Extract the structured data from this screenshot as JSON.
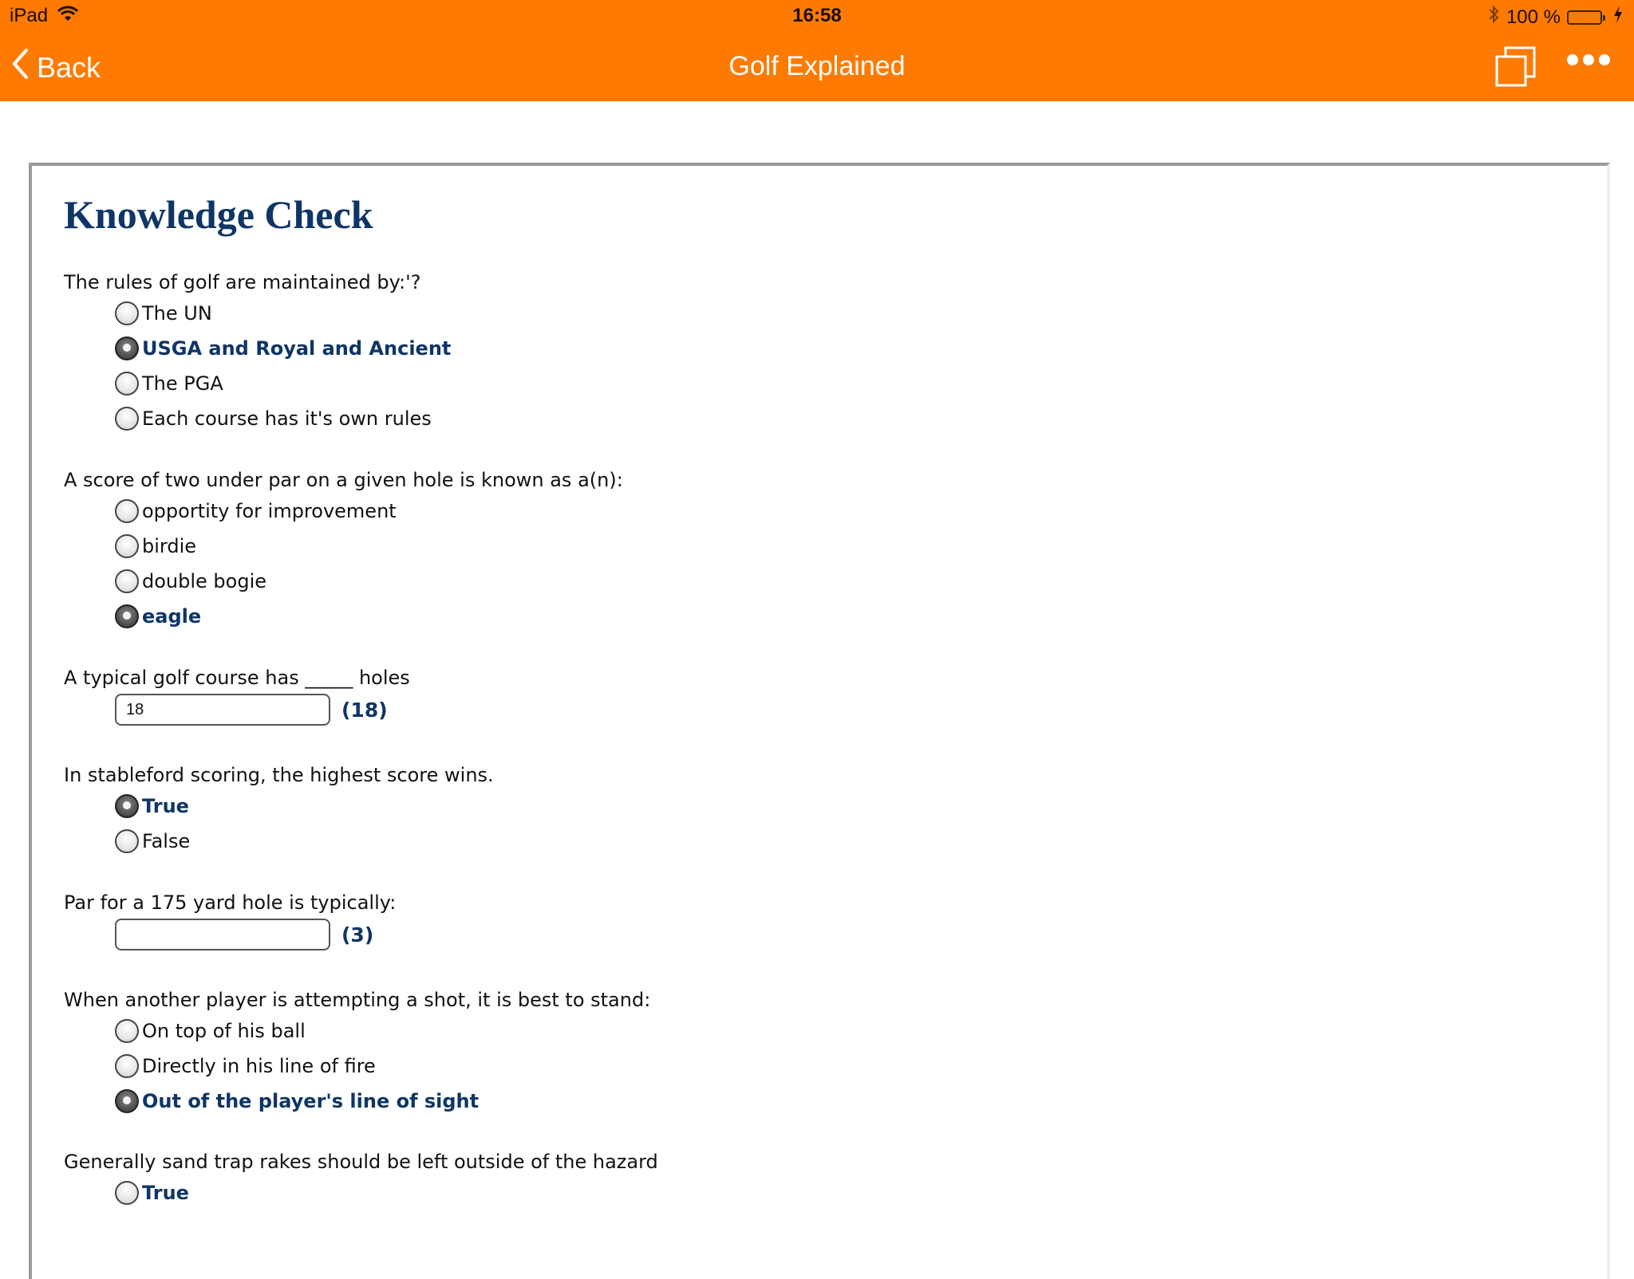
{
  "status_bar": {
    "device": "iPad",
    "time": "16:58",
    "battery_percent": "100 %",
    "battery_level": 1.0,
    "colors": {
      "battery_fill": "#4cd964"
    }
  },
  "nav": {
    "back_label": "Back",
    "title": "Golf Explained",
    "icons": [
      "chevron-left-icon",
      "copy-icon",
      "more-icon"
    ],
    "colors": {
      "bar": "#ff7a00",
      "text": "#ffffff"
    }
  },
  "page": {
    "title": "Knowledge Check",
    "colors": {
      "title": "#0e3566",
      "correct": "#0e3566"
    },
    "questions": [
      {
        "text": "The rules of golf are maintained by:'?",
        "type": "radio",
        "options": [
          {
            "label": "The UN",
            "selected": false,
            "correct": false
          },
          {
            "label": "USGA and Royal and Ancient",
            "selected": true,
            "correct": true
          },
          {
            "label": "The PGA",
            "selected": false,
            "correct": false
          },
          {
            "label": "Each course has it's own rules",
            "selected": false,
            "correct": false
          }
        ]
      },
      {
        "text": "A score of two under par on a given hole is known as a(n):",
        "type": "radio",
        "options": [
          {
            "label": "opportity for improvement",
            "selected": false,
            "correct": false
          },
          {
            "label": "birdie",
            "selected": false,
            "correct": false
          },
          {
            "label": "double bogie",
            "selected": false,
            "correct": false
          },
          {
            "label": "eagle",
            "selected": true,
            "correct": true
          }
        ]
      },
      {
        "text": "A typical golf course has _____ holes",
        "type": "fill",
        "value": "18",
        "answer": "(18)"
      },
      {
        "text": "In stableford scoring, the highest score wins.",
        "type": "radio",
        "options": [
          {
            "label": "True",
            "selected": true,
            "correct": true
          },
          {
            "label": "False",
            "selected": false,
            "correct": false
          }
        ]
      },
      {
        "text": "Par for a 175 yard hole is typically:",
        "type": "fill",
        "value": "",
        "answer": "(3)"
      },
      {
        "text": "When another player is attempting a shot, it is best to stand:",
        "type": "radio",
        "options": [
          {
            "label": "On top of his ball",
            "selected": false,
            "correct": false
          },
          {
            "label": "Directly in his line of fire",
            "selected": false,
            "correct": false
          },
          {
            "label": "Out of the player's line of sight",
            "selected": true,
            "correct": true
          }
        ]
      },
      {
        "text": "Generally sand trap rakes should be left outside of the hazard",
        "type": "radio",
        "options": [
          {
            "label": "True",
            "selected": false,
            "correct": true
          }
        ]
      }
    ]
  }
}
